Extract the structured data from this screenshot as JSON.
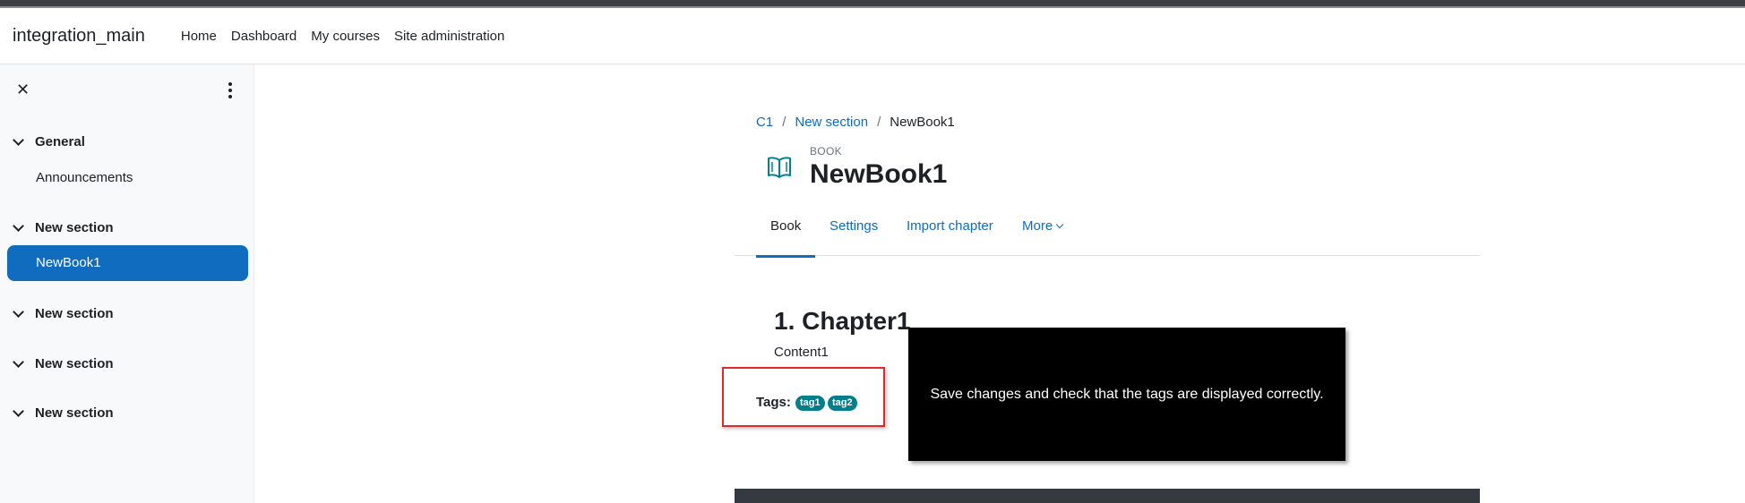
{
  "navbar": {
    "brand": "integration_main",
    "links": [
      "Home",
      "Dashboard",
      "My courses",
      "Site administration"
    ]
  },
  "drawer": {
    "close_icon": "close-icon",
    "menu_icon": "kebab-menu-icon",
    "sections": [
      {
        "label": "General",
        "items": [
          "Announcements"
        ]
      },
      {
        "label": "New section",
        "items": [
          "NewBook1"
        ],
        "active_item": "NewBook1"
      },
      {
        "label": "New section",
        "items": []
      },
      {
        "label": "New section",
        "items": []
      },
      {
        "label": "New section",
        "items": []
      }
    ]
  },
  "breadcrumb": {
    "items": [
      "C1",
      "New section",
      "NewBook1"
    ],
    "separator": "/"
  },
  "header": {
    "module_type": "BOOK",
    "title": "NewBook1",
    "icon": "book-icon"
  },
  "tabs": [
    "Book",
    "Settings",
    "Import chapter",
    "More"
  ],
  "chapter": {
    "title": "1. Chapter1",
    "content": "Content1"
  },
  "tags": {
    "label": "Tags:",
    "items": [
      "tag1",
      "tag2"
    ]
  },
  "callout": {
    "text": "Save changes and check that the tags are displayed correctly."
  },
  "colors": {
    "primary": "#0f6cbf",
    "tag_bg": "#007e8c",
    "highlight_border": "#e0292b",
    "callout_bg": "#000000"
  }
}
